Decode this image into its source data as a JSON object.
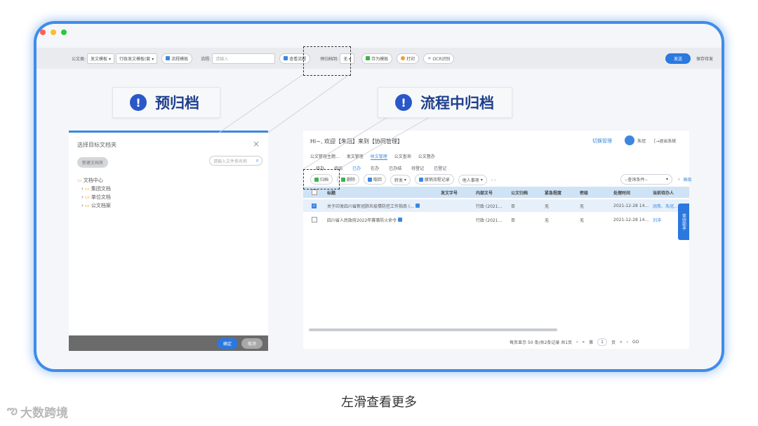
{
  "toolbar": {
    "doc_label": "公文类:",
    "doc_value": "发文模板",
    "type_value": "行政发文模板(套",
    "flow_template_btn": "流程模板",
    "flow_label": "流程:",
    "flow_placeholder": "请输入",
    "view_flow_btn": "查看流程",
    "pre_archive_label": "预归档到:",
    "pre_archive_value": "无",
    "save_template_btn": "存为模板",
    "print_btn": "打印",
    "ocr_btn": "OCR识别",
    "send_btn": "发送",
    "save_draft_btn": "保存待发"
  },
  "callouts": {
    "pre_archive": "预归档",
    "in_flow_archive": "流程中归档"
  },
  "dialog": {
    "title": "选择目标文档夹",
    "new_folder_btn": "新建文档夹",
    "search_placeholder": "请输入文件夹名称",
    "tree_root": "文档中心",
    "tree_items": [
      "集团文档",
      "单位文档",
      "公文档案"
    ],
    "confirm_btn": "确定",
    "cancel_btn": "取消"
  },
  "right": {
    "greeting": "Hi~, 欢迎【朱冠】来到【协同管理】",
    "header_link": "切换管理",
    "user_name": "朱冠",
    "logout": "退出系统",
    "tabs": [
      "公文管理主题...",
      "发文管理",
      "收文管理",
      "公文查询",
      "公文督办"
    ],
    "subtabs": [
      "待办",
      "待阅",
      "已办",
      "在办",
      "已办结",
      "待登记",
      "已登记"
    ],
    "actions": [
      "归档",
      "删除",
      "取回",
      "转发",
      "撤销流程记录",
      "他人事项"
    ],
    "filter_placeholder": "--查询条件--",
    "advanced": "高级",
    "columns": [
      "标题",
      "发文字号",
      "内部文号",
      "公文归档",
      "紧急程度",
      "密级",
      "处理时间",
      "当前待办人"
    ],
    "rows": [
      {
        "title": "关于印发四川省新冠肺炎疫情防控工作指南 (...",
        "num": "",
        "internal": "行政 (2021...",
        "archived": "否",
        "urgency": "无",
        "secret": "无",
        "time": "2021-12-28 14...",
        "pending": "润希、朱冠..."
      },
      {
        "title": "四川省人民政府2022年赛事防火命令",
        "num": "",
        "internal": "行政 (2021...",
        "archived": "否",
        "urgency": "无",
        "secret": "无",
        "time": "2021-12-28 14...",
        "pending": "刘冲"
      }
    ],
    "pagination": "每页显示 50 条/共2条记录 共1页",
    "page_num": "1",
    "page_suffix": "页",
    "go": "GO",
    "side_widget": "体验助手"
  },
  "caption": "左滑查看更多",
  "watermark": "大数跨境",
  "colors": {
    "accent": "#3b87e0",
    "callout_text": "#1f3f8c",
    "frame_border": "#3f8ce8"
  }
}
